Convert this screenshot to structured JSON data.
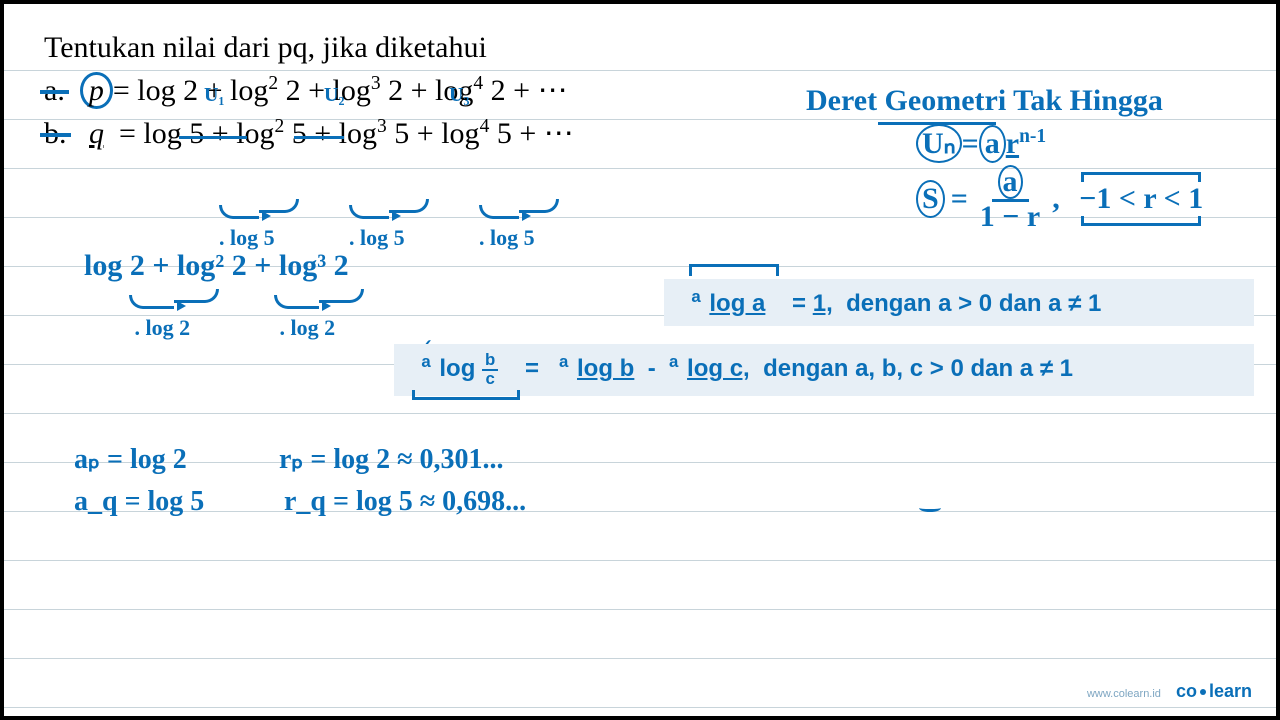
{
  "problem": {
    "title": "Tentukan nilai dari pq, jika diketahui",
    "item_a_label": "a.",
    "item_b_label": "b.",
    "p_var": "p",
    "q_var": "q",
    "eq": "=",
    "plus": "+",
    "dots": "⋯",
    "log": "log",
    "two": "2",
    "five": "5",
    "pow2": "2",
    "pow3": "3",
    "pow4": "4"
  },
  "annotations": {
    "u1": "U₁",
    "u2": "U₂",
    "u3": "U₃",
    "dotlog5_1": ". log 5",
    "dotlog5_2": ". log 5",
    "dotlog5_3": ". log 5",
    "log_series": "log 2  +  log² 2  +  log³ 2",
    "dotlog2_1": ". log 2",
    "dotlog2_2": ". log 2",
    "checkmark": "✓"
  },
  "right_notes": {
    "heading": "Deret  Geometri  Tak  Hingga",
    "un_left": "Uₙ",
    "un_eq": "=",
    "un_a": "a",
    "un_r": "r",
    "un_exp": "n-1",
    "s_left": "S",
    "s_eq": "=",
    "s_num": "a",
    "s_den": "1 − r",
    "comma": ",",
    "r_range": "−1 < r < 1"
  },
  "formula1": {
    "pre": "a",
    "log": "log a",
    "eq": "=",
    "one": "1,",
    "cond": "dengan a > 0 dan a ≠ 1"
  },
  "formula2": {
    "pre": "a",
    "log": "log",
    "frac_num": "b",
    "frac_den": "c",
    "eq": "=",
    "pre2": "a",
    "logb": "log b",
    "minus": "-",
    "pre3": "a",
    "logc": "log c,",
    "cond": "dengan a, b, c  > 0 dan a ≠ 1"
  },
  "bottom": {
    "ap": "aₚ = log 2",
    "aq": "a_q = log 5",
    "rp": "rₚ = log 2 ≈ 0,301...",
    "rq": "r_q = log 5 ≈ 0,698..."
  },
  "brand": {
    "url": "www.colearn.id",
    "name_left": "co",
    "name_right": "learn"
  }
}
